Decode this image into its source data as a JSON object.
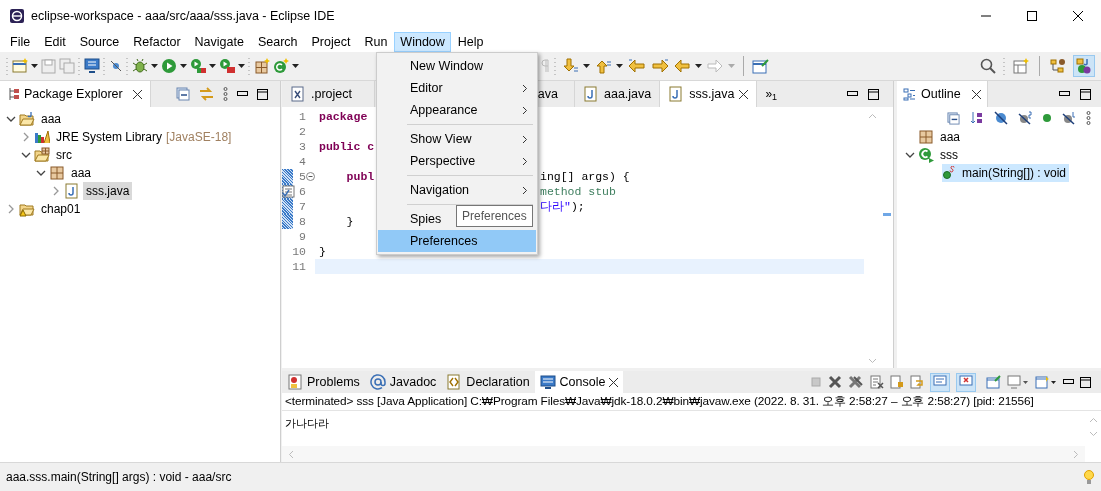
{
  "window": {
    "title": "eclipse-workspace - aaa/src/aaa/sss.java - Eclipse IDE"
  },
  "menu_bar": [
    {
      "label": "File",
      "selected": false
    },
    {
      "label": "Edit",
      "selected": false
    },
    {
      "label": "Source",
      "selected": false
    },
    {
      "label": "Refactor",
      "selected": false
    },
    {
      "label": "Navigate",
      "selected": false
    },
    {
      "label": "Search",
      "selected": false
    },
    {
      "label": "Project",
      "selected": false
    },
    {
      "label": "Run",
      "selected": false
    },
    {
      "label": "Window",
      "selected": true
    },
    {
      "label": "Help",
      "selected": false
    }
  ],
  "open_menu": {
    "items": [
      {
        "kind": "item",
        "label": "New Window",
        "submenu": false,
        "selected": false
      },
      {
        "kind": "item",
        "label": "Editor",
        "submenu": true,
        "selected": false
      },
      {
        "kind": "item",
        "label": "Appearance",
        "submenu": true,
        "selected": false
      },
      {
        "kind": "separator"
      },
      {
        "kind": "item",
        "label": "Show View",
        "submenu": true,
        "selected": false
      },
      {
        "kind": "item",
        "label": "Perspective",
        "submenu": true,
        "selected": false
      },
      {
        "kind": "separator"
      },
      {
        "kind": "item",
        "label": "Navigation",
        "submenu": true,
        "selected": false
      },
      {
        "kind": "separator"
      },
      {
        "kind": "item",
        "label": "Spies",
        "submenu": false,
        "selected": false
      },
      {
        "kind": "item",
        "label": "Preferences",
        "submenu": false,
        "selected": true
      }
    ]
  },
  "tooltip": "Preferences",
  "package_explorer": {
    "title": "Package Explorer",
    "tree": [
      {
        "label": "aaa",
        "kind": "project",
        "expanded": true,
        "selected": false,
        "children": [
          {
            "label": "JRE System Library",
            "decoration": "[JavaSE-18]",
            "kind": "library",
            "expanded": false,
            "selected": false
          },
          {
            "label": "src",
            "kind": "source-folder",
            "expanded": true,
            "selected": false,
            "children": [
              {
                "label": "aaa",
                "kind": "package",
                "expanded": true,
                "selected": false,
                "children": [
                  {
                    "label": "sss.java",
                    "kind": "java-file",
                    "expanded": false,
                    "selected": true
                  }
                ]
              }
            ]
          }
        ]
      },
      {
        "label": "chap01",
        "kind": "project-warning",
        "expanded": false,
        "selected": false
      }
    ]
  },
  "editor": {
    "tabs": [
      {
        "label": ".project",
        "kind": "xml",
        "selected": false
      },
      {
        "label": "ava",
        "selected": false
      },
      {
        "label": "aaa.java",
        "kind": "java",
        "selected": false
      },
      {
        "label": "sss.java",
        "kind": "java",
        "selected": true
      }
    ],
    "overflow": "»$_{1}$",
    "lines": [
      {
        "number": "1",
        "left": [
          {
            "text": "package",
            "kind": "keyword"
          }
        ],
        "changed": false,
        "current": false,
        "fold": false,
        "task": false
      },
      {
        "number": "2",
        "changed": false,
        "current": false,
        "fold": false,
        "task": false
      },
      {
        "number": "3",
        "left": [
          {
            "text": "public c",
            "kind": "keyword"
          }
        ],
        "changed": false,
        "current": false,
        "fold": false,
        "task": false
      },
      {
        "number": "4",
        "changed": false,
        "current": false,
        "fold": false,
        "task": false
      },
      {
        "number": "5",
        "left": [
          {
            "text": "    publ",
            "kind": "keyword"
          }
        ],
        "right": [
          {
            "text": "ing[] args) {",
            "kind": "plain"
          }
        ],
        "changed": true,
        "current": false,
        "fold": true,
        "task": false
      },
      {
        "number": "6",
        "right": [
          {
            "text": "method stub",
            "kind": "comment"
          }
        ],
        "changed": true,
        "current": false,
        "fold": false,
        "task": true
      },
      {
        "number": "7",
        "right": [
          {
            "text": "다라\"",
            "kind": "string"
          },
          {
            "text": ");",
            "kind": "plain"
          }
        ],
        "changed": true,
        "current": false,
        "fold": false,
        "task": false
      },
      {
        "number": "8",
        "left": [
          {
            "text": "    }",
            "kind": "plain"
          }
        ],
        "changed": true,
        "current": false,
        "fold": false,
        "task": false
      },
      {
        "number": "9",
        "changed": false,
        "current": false,
        "fold": false,
        "task": false
      },
      {
        "number": "10",
        "left": [
          {
            "text": "}",
            "kind": "plain"
          }
        ],
        "changed": false,
        "current": false,
        "fold": false,
        "task": false
      },
      {
        "number": "11",
        "changed": false,
        "current": true,
        "fold": false,
        "task": false
      }
    ]
  },
  "outline": {
    "title": "Outline",
    "tree": [
      {
        "label": "aaa",
        "kind": "package",
        "selected": false
      },
      {
        "label": "sss",
        "kind": "class",
        "expanded": true,
        "selected": false,
        "children": [
          {
            "label": "main(String[]) : void",
            "kind": "method",
            "selected": true
          }
        ]
      }
    ]
  },
  "console": {
    "tabs": [
      {
        "label": "Problems",
        "kind": "problems",
        "selected": false
      },
      {
        "label": "Javadoc",
        "kind": "at",
        "selected": false
      },
      {
        "label": "Declaration",
        "kind": "declaration",
        "selected": false
      },
      {
        "label": "Console",
        "kind": "console",
        "selected": true
      }
    ],
    "header": "<terminated> sss [Java Application] C:₩Program Files₩Java₩jdk-18.0.2₩bin₩javaw.exe  (2022. 8. 31. 오후 2:58:27 – 오후 2:58:27) [pid: 21556]",
    "output": "가나다라"
  },
  "status_bar": {
    "text": "aaa.sss.main(String[] args) : void - aaa/src"
  }
}
